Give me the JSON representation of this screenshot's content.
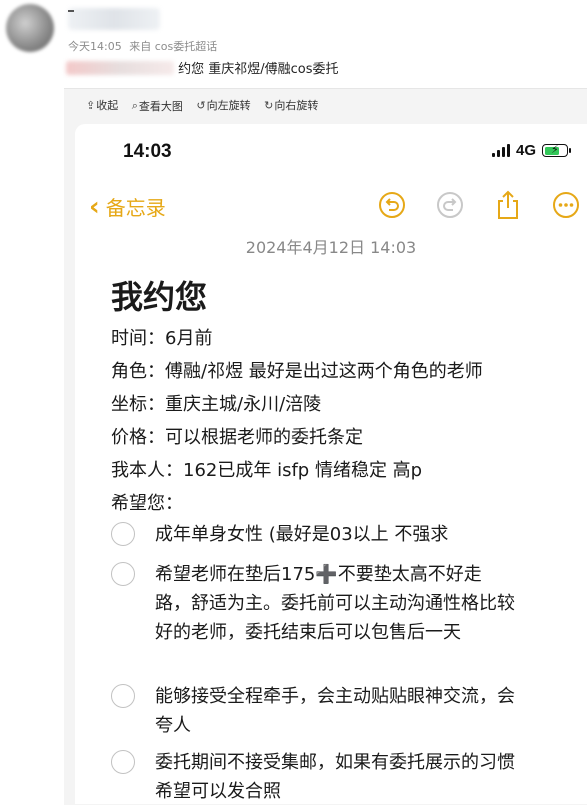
{
  "post": {
    "time": "今天14:05",
    "source": "来自 cos委托超话",
    "text": "约您 重庆祁煜/傅融cos委托"
  },
  "viewer": {
    "tools": [
      {
        "icon": "collapse-icon",
        "glyph": "⇪",
        "label": "收起"
      },
      {
        "icon": "zoom-icon",
        "glyph": "⌕",
        "label": "查看大图"
      },
      {
        "icon": "rotate-left-icon",
        "glyph": "↺",
        "label": "向左旋转"
      },
      {
        "icon": "rotate-right-icon",
        "glyph": "↻",
        "label": "向右旋转"
      }
    ]
  },
  "phone": {
    "status": {
      "time": "14:03",
      "network": "4G",
      "battery_color": "#33c759",
      "battery_level": 0.7
    },
    "nav": {
      "back_label": "备忘录",
      "accent": "#e6a817"
    },
    "date": "2024年4月12日 14:03",
    "title": "我约您",
    "fields": [
      "时间：6月前",
      "角色：傅融/祁煜 最好是出过这两个角色的老师",
      "坐标：重庆主城/永川/涪陵",
      "价格：可以根据老师的委托条定",
      "我本人：162已成年 isfp 情绪稳定 高p",
      "希望您："
    ],
    "checklist": [
      "成年单身女性 (最好是03以上 不强求",
      "希望老师在垫后175➕不要垫太高不好走路，舒适为主。委托前可以主动沟通性格比较好的老师，委托结束后可以包售后一天",
      "能够接受全程牵手，会主动贴贴眼神交流，会夸人",
      "委托期间不接受集邮，如果有委托展示的习惯希望可以发合照"
    ]
  }
}
